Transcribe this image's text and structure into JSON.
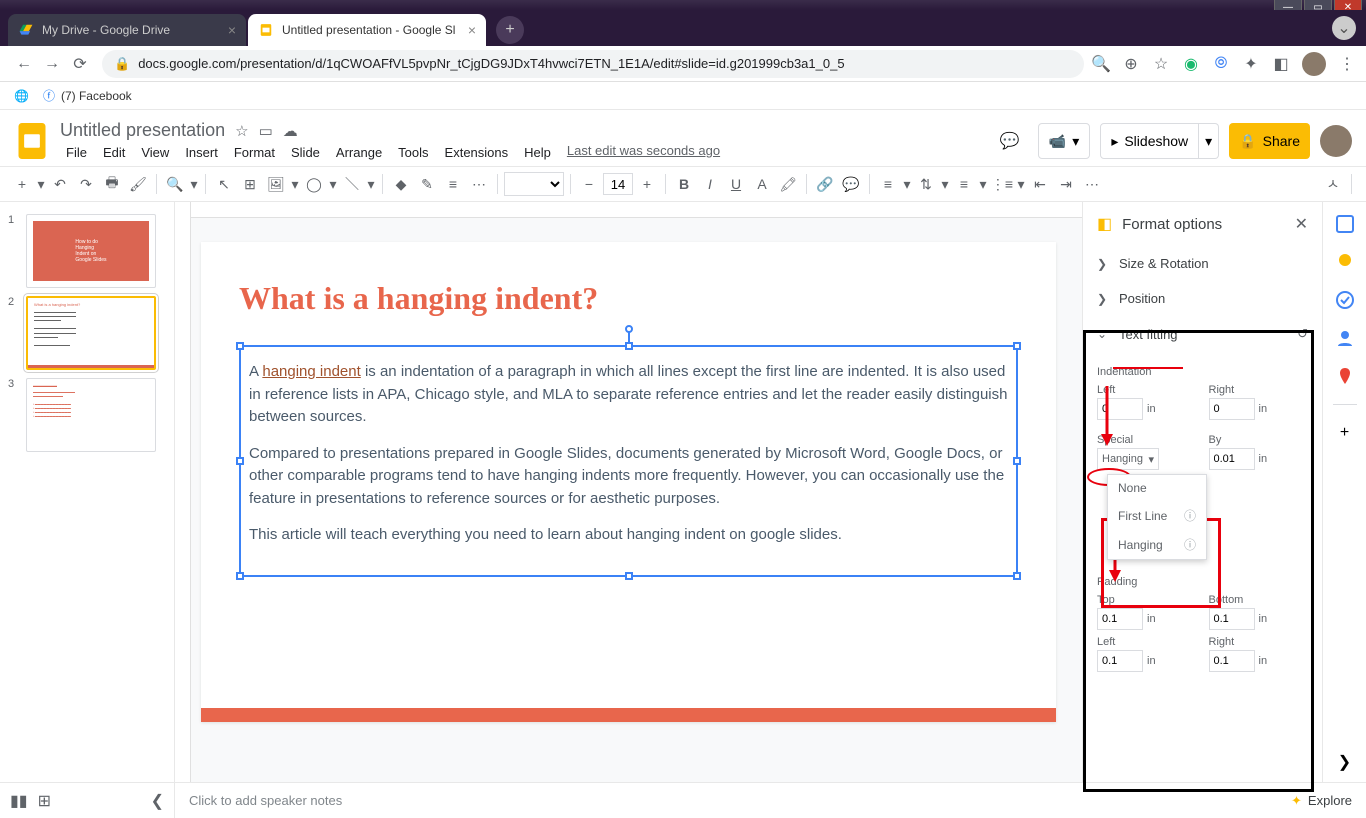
{
  "window": {
    "min": "—",
    "max": "▭",
    "close": "✕"
  },
  "tabs": [
    {
      "title": "My Drive - Google Drive",
      "active": false
    },
    {
      "title": "Untitled presentation - Google Sl",
      "active": true
    }
  ],
  "url": "docs.google.com/presentation/d/1qCWOAFfVL5pvpNr_tCjgDG9JDxT4hvwci7ETN_1E1A/edit#slide=id.g201999cb3a1_0_5",
  "bookmarks": {
    "facebook": "(7) Facebook"
  },
  "doc_title": "Untitled presentation",
  "menus": [
    "File",
    "Edit",
    "View",
    "Insert",
    "Format",
    "Slide",
    "Arrange",
    "Tools",
    "Extensions",
    "Help"
  ],
  "last_edit": "Last edit was seconds ago",
  "header_buttons": {
    "slideshow": "Slideshow",
    "share": "Share"
  },
  "toolbar": {
    "font_size": "14"
  },
  "slides_panel": {
    "slides": [
      {
        "num": "1"
      },
      {
        "num": "2"
      },
      {
        "num": "3"
      }
    ]
  },
  "slide_content": {
    "title": "What is a hanging indent?",
    "link_text": "hanging indent",
    "p1a": "A ",
    "p1b": " is an indentation of a paragraph in which all lines except the first line are indented. It is also used in reference lists in APA, Chicago style, and MLA to separate reference entries and let the reader easily distinguish between sources.",
    "p2": "Compared to presentations prepared in Google Slides, documents generated by Microsoft Word, Google Docs, or other comparable programs tend to have hanging indents more frequently. However, you can occasionally use the feature in presentations to reference sources or for aesthetic purposes.",
    "p3": "This article will teach everything you need to learn about hanging indent on google slides."
  },
  "format_panel": {
    "title": "Format options",
    "sections": {
      "size_rotation": "Size & Rotation",
      "position": "Position",
      "text_fitting": "Text fitting"
    },
    "indentation": {
      "label": "Indentation",
      "left_label": "Left",
      "left_value": "0",
      "right_label": "Right",
      "right_value": "0",
      "unit": "in",
      "special_label": "Special",
      "special_value": "Hanging",
      "by_label": "By",
      "by_value": "0.01",
      "options": {
        "none": "None",
        "first_line": "First Line",
        "hanging": "Hanging"
      }
    },
    "padding": {
      "label": "Padding",
      "top_label": "Top",
      "top_value": "0.1",
      "bottom_label": "Bottom",
      "bottom_value": "0.1",
      "left_label": "Left",
      "left_value": "0.1",
      "right_label": "Right",
      "right_value": "0.1",
      "unit": "in"
    }
  },
  "speaker_notes_placeholder": "Click to add speaker notes",
  "explore": "Explore"
}
